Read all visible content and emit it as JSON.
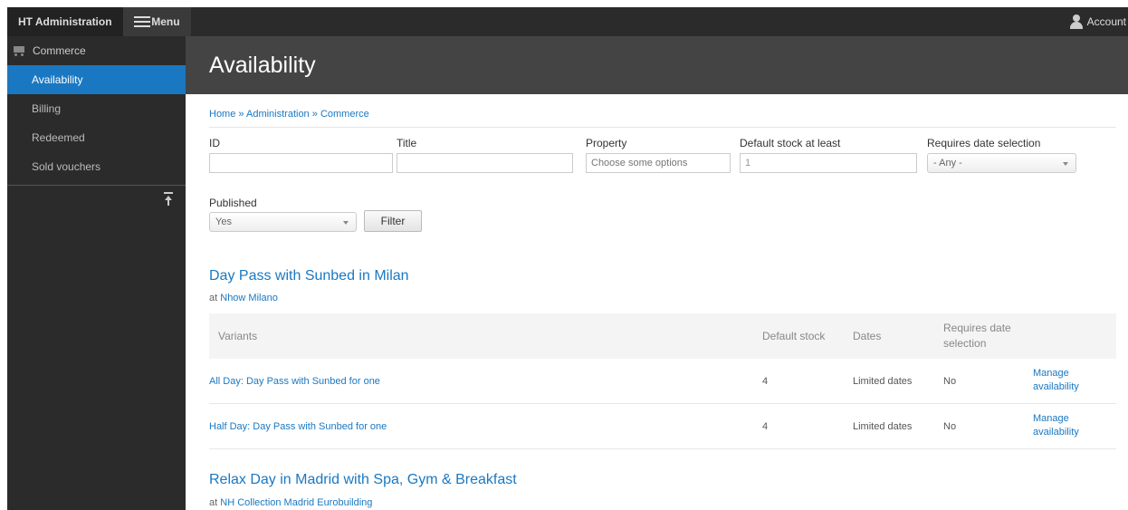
{
  "toolbar": {
    "brand": "HT Administration",
    "menu_label": "Menu",
    "account_label": "Account"
  },
  "sidebar": {
    "section_label": "Commerce",
    "items": [
      {
        "label": "Availability",
        "active": true
      },
      {
        "label": "Billing",
        "active": false
      },
      {
        "label": "Redeemed",
        "active": false
      },
      {
        "label": "Sold vouchers",
        "active": false
      }
    ]
  },
  "page": {
    "title": "Availability"
  },
  "breadcrumb": {
    "items": [
      "Home",
      "Administration",
      "Commerce"
    ],
    "separator": "»"
  },
  "filters": {
    "id_label": "ID",
    "id_value": "",
    "title_label": "Title",
    "title_value": "",
    "property_label": "Property",
    "property_placeholder": "Choose some options",
    "stock_label": "Default stock at least",
    "stock_value": "1",
    "date_sel_label": "Requires date selection",
    "date_sel_value": "- Any -",
    "published_label": "Published",
    "published_value": "Yes",
    "filter_button": "Filter"
  },
  "table_headers": {
    "variants": "Variants",
    "default_stock": "Default stock",
    "dates": "Dates",
    "requires_date_1": "Requires date",
    "requires_date_2": "selection"
  },
  "products": [
    {
      "title": "Day Pass with Sunbed in Milan",
      "at_prefix": "at",
      "venue": "Nhow Milano",
      "variants": [
        {
          "name": "All Day: Day Pass with Sunbed for one",
          "stock": "4",
          "dates": "Limited dates",
          "requires_date": "No",
          "action_1": "Manage",
          "action_2": "availability"
        },
        {
          "name": "Half Day: Day Pass with Sunbed for one",
          "stock": "4",
          "dates": "Limited dates",
          "requires_date": "No",
          "action_1": "Manage",
          "action_2": "availability"
        }
      ]
    },
    {
      "title": "Relax Day in Madrid with Spa, Gym & Breakfast",
      "at_prefix": "at",
      "venue": "NH Collection Madrid Eurobuilding"
    }
  ],
  "colors": {
    "accent": "#1a78c2",
    "toolbar_bg": "#2b2b2b",
    "header_bg": "#444444"
  }
}
